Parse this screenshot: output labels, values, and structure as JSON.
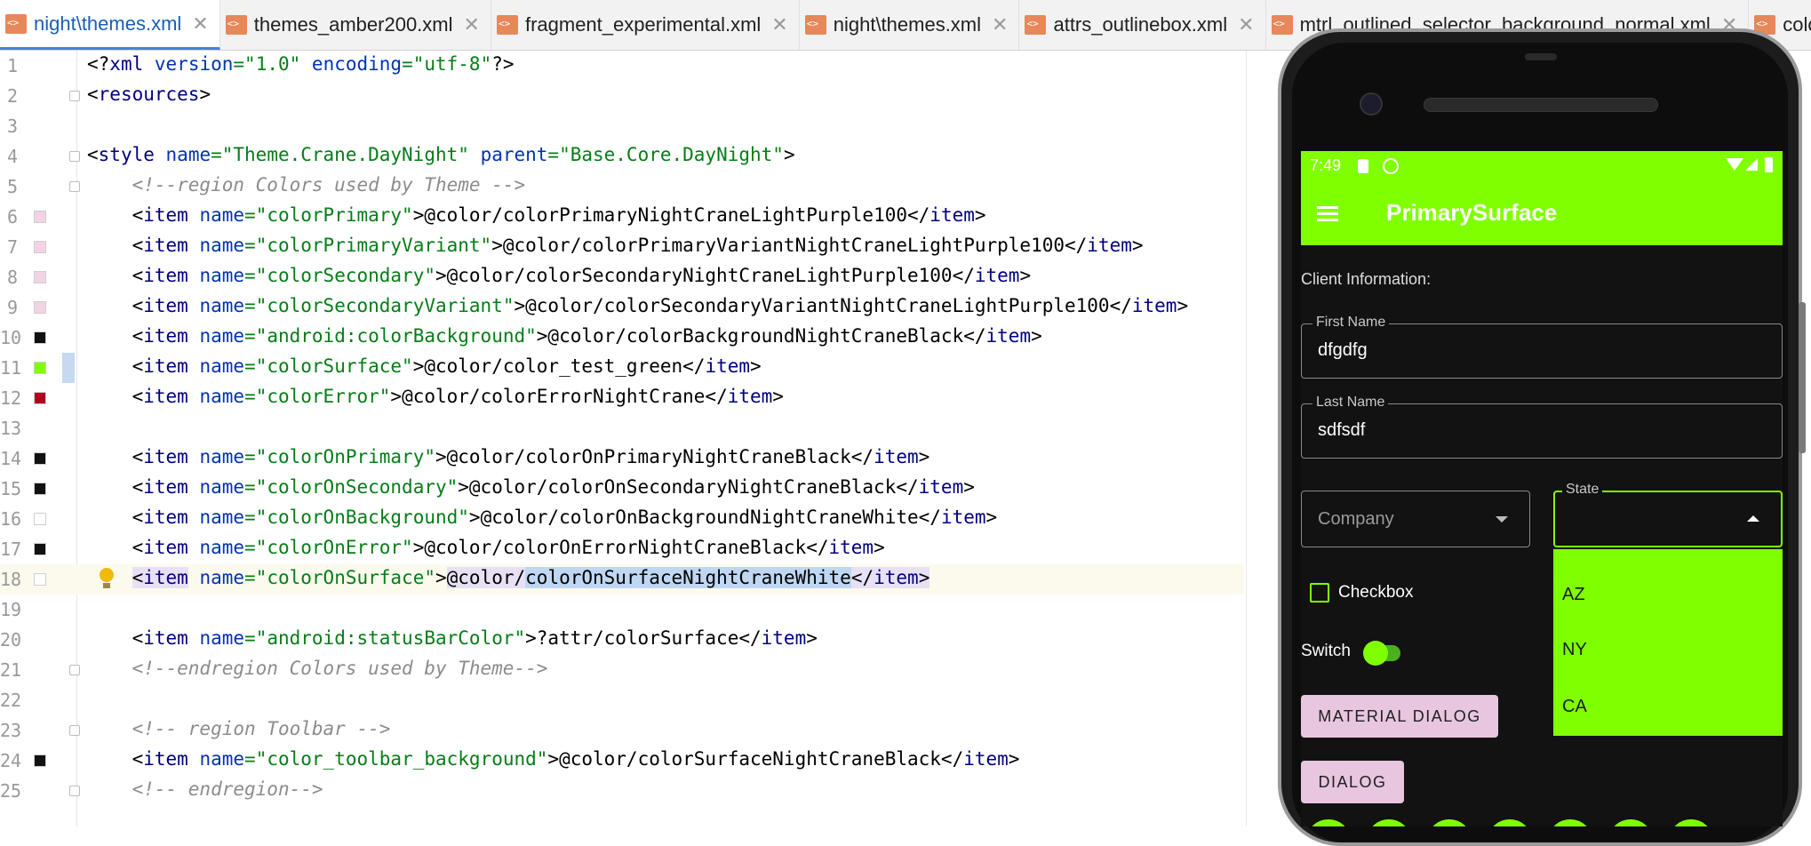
{
  "tabs": [
    {
      "label": "night\\themes.xml",
      "active": true
    },
    {
      "label": "themes_amber200.xml",
      "active": false
    },
    {
      "label": "fragment_experimental.xml",
      "active": false
    },
    {
      "label": "night\\themes.xml",
      "active": false
    },
    {
      "label": "attrs_outlinebox.xml",
      "active": false
    },
    {
      "label": "mtrl_outlined_selector_background_normal.xml",
      "active": false
    },
    {
      "label": "colors.x",
      "active": false
    }
  ],
  "editor": {
    "lines": [
      {
        "n": "1"
      },
      {
        "n": "2"
      },
      {
        "n": "3"
      },
      {
        "n": "4"
      },
      {
        "n": "5"
      },
      {
        "n": "6"
      },
      {
        "n": "7"
      },
      {
        "n": "8"
      },
      {
        "n": "9"
      },
      {
        "n": "10"
      },
      {
        "n": "11"
      },
      {
        "n": "12"
      },
      {
        "n": "13"
      },
      {
        "n": "14"
      },
      {
        "n": "15"
      },
      {
        "n": "16"
      },
      {
        "n": "17"
      },
      {
        "n": "18"
      },
      {
        "n": "19"
      },
      {
        "n": "20"
      },
      {
        "n": "21"
      },
      {
        "n": "22"
      },
      {
        "n": "23"
      },
      {
        "n": "24"
      },
      {
        "n": "25"
      }
    ],
    "swatches": {
      "6": "#f2d4e4",
      "7": "#f2d4e4",
      "8": "#f2d4e4",
      "9": "#f2d4e4",
      "10": "#111111",
      "11": "#80ff00",
      "12": "#b00020",
      "14": "#111111",
      "15": "#111111",
      "16": "#ffffff",
      "17": "#111111",
      "18": "#ffffff",
      "24": "#111111"
    }
  },
  "phone": {
    "status_time": "7:49",
    "app_title": "PrimarySurface",
    "client_info": "Client Information:",
    "first_name_label": "First Name",
    "first_name_value": "dfgdfg",
    "last_name_label": "Last Name",
    "last_name_value": "sdfsdf",
    "company_placeholder": "Company",
    "state_label": "State",
    "state_options": [
      "AZ",
      "NY",
      "CA"
    ],
    "checkbox_label": "Checkbox",
    "switch_label": "Switch",
    "material_dialog_button": "MATERIAL DIALOG",
    "dialog_button": "DIALOG",
    "accent": "#80ff00",
    "button_color": "#e8c6e0"
  }
}
